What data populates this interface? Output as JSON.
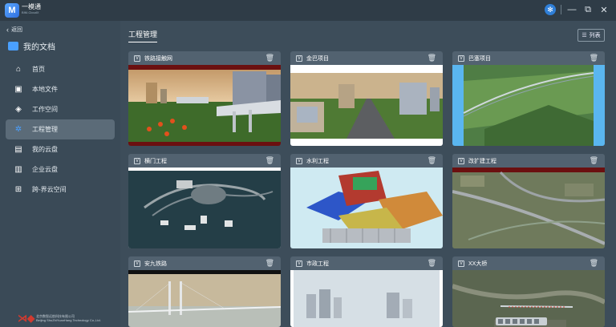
{
  "app": {
    "name": "一模通",
    "sub": "BIM-CloudX"
  },
  "sidebar": {
    "back_label": "返回",
    "section_title": "我的文档",
    "items": [
      {
        "label": "首页",
        "icon": "home-icon"
      },
      {
        "label": "本地文件",
        "icon": "local-file-icon"
      },
      {
        "label": "工作空间",
        "icon": "layers-icon"
      },
      {
        "label": "工程管理",
        "icon": "project-icon",
        "active": true
      },
      {
        "label": "我的云盘",
        "icon": "cloud-disk-icon"
      },
      {
        "label": "企业云盘",
        "icon": "enterprise-disk-icon"
      },
      {
        "label": "跨-界云空间",
        "icon": "cross-space-icon"
      }
    ],
    "footer_company": "北京数智远航科技有限公司",
    "footer_company_en": "Beijing ShuZhiYuanHang Technology Co.,Ltd."
  },
  "main": {
    "title": "工程管理",
    "view_toggle_label": "列表",
    "projects": [
      {
        "name": "铁路接触网"
      },
      {
        "name": "金巴项目"
      },
      {
        "name": "巴塞项目"
      },
      {
        "name": "横门工程"
      },
      {
        "name": "水利工程"
      },
      {
        "name": "改扩建工程"
      },
      {
        "name": "安九铁路"
      },
      {
        "name": "市政工程"
      },
      {
        "name": "XX大桥"
      }
    ]
  },
  "colors": {
    "accent": "#2f7fd8",
    "sidebar_bg": "#3a4a57",
    "card_bg": "#526270"
  }
}
